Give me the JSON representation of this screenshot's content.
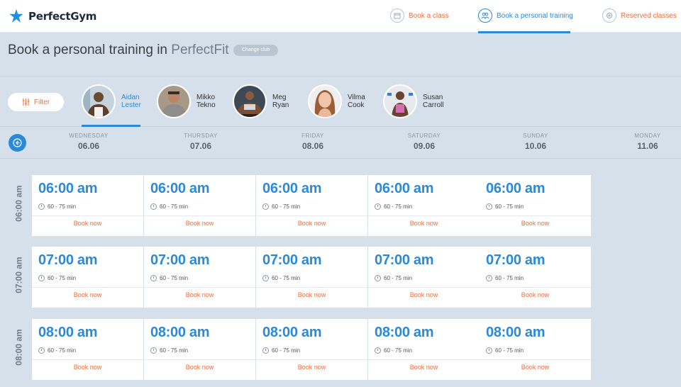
{
  "app": {
    "brand": "PerfectGym"
  },
  "nav": {
    "book_class": "Book a class",
    "book_personal": "Book a personal training",
    "reserved": "Reserved classes"
  },
  "header": {
    "title": "Book a personal training in ",
    "club": "PerfectFit",
    "change_club": "Change club"
  },
  "filter": {
    "label": "Filter"
  },
  "trainers": [
    {
      "first": "Aidan",
      "last": "Lester"
    },
    {
      "first": "Mikko",
      "last": "Tekno"
    },
    {
      "first": "Meg",
      "last": "Ryan"
    },
    {
      "first": "Vilma",
      "last": "Cook"
    },
    {
      "first": "Susan",
      "last": "Carroll"
    }
  ],
  "days": [
    {
      "name": "WEDNESDAY",
      "date": "06.06"
    },
    {
      "name": "THURSDAY",
      "date": "07.06"
    },
    {
      "name": "FRIDAY",
      "date": "08.06"
    },
    {
      "name": "SATURDAY",
      "date": "09.06"
    },
    {
      "name": "SUNDAY",
      "date": "10.06"
    },
    {
      "name": "MONDAY",
      "date": "11.06"
    }
  ],
  "slots": [
    {
      "label": "06:00 am",
      "time": "06:00 am",
      "duration": "60 - 75 min",
      "book": "Book now"
    },
    {
      "label": "07:00 am",
      "time": "07:00 am",
      "duration": "60 - 75 min",
      "book": "Book now"
    },
    {
      "label": "08:00 am",
      "time": "08:00 am",
      "duration": "60 - 75 min",
      "book": "Book now"
    }
  ],
  "colors": {
    "accent": "#2b8ad8",
    "action": "#ef6e3a"
  }
}
